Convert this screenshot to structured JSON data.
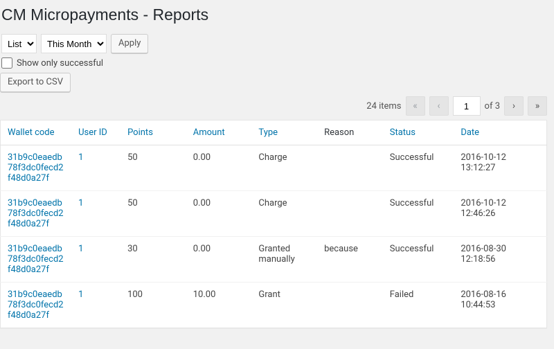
{
  "page": {
    "title": "CM Micropayments - Reports"
  },
  "filters": {
    "view_select": "List",
    "range_select": "This Month",
    "apply_label": "Apply",
    "show_successful_label": "Show only successful",
    "export_label": "Export to CSV"
  },
  "pagination": {
    "items_label": "24 items",
    "current_page": "1",
    "of_label": "of 3",
    "first": "«",
    "prev": "‹",
    "next": "›",
    "last": "»"
  },
  "columns": {
    "wallet": "Wallet code",
    "user": "User ID",
    "points": "Points",
    "amount": "Amount",
    "type": "Type",
    "reason": "Reason",
    "status": "Status",
    "date": "Date"
  },
  "rows": [
    {
      "wallet": "31b9c0eaedb78f3dc0fecd2f48d0a27f",
      "user": "1",
      "points": "50",
      "amount": "0.00",
      "type": "Charge",
      "reason": "",
      "status": "Successful",
      "date": "2016-10-12 13:12:27"
    },
    {
      "wallet": "31b9c0eaedb78f3dc0fecd2f48d0a27f",
      "user": "1",
      "points": "50",
      "amount": "0.00",
      "type": "Charge",
      "reason": "",
      "status": "Successful",
      "date": "2016-10-12 12:46:26"
    },
    {
      "wallet": "31b9c0eaedb78f3dc0fecd2f48d0a27f",
      "user": "1",
      "points": "30",
      "amount": "0.00",
      "type": "Granted manually",
      "reason": "because",
      "status": "Successful",
      "date": "2016-08-30 12:18:56"
    },
    {
      "wallet": "31b9c0eaedb78f3dc0fecd2f48d0a27f",
      "user": "1",
      "points": "100",
      "amount": "10.00",
      "type": "Grant",
      "reason": "",
      "status": "Failed",
      "date": "2016-08-16 10:44:53"
    }
  ]
}
